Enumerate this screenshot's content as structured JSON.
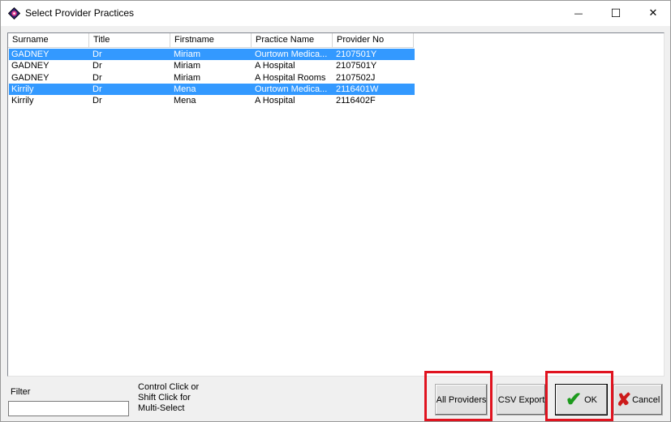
{
  "window": {
    "title": "Select Provider Practices",
    "minimize_glyph": "—",
    "maximize_glyph": "☐",
    "close_glyph": "✕"
  },
  "list": {
    "columns": [
      "Surname",
      "Title",
      "Firstname",
      "Practice Name",
      "Provider No"
    ],
    "rows": [
      {
        "selected": true,
        "cells": [
          "GADNEY",
          "Dr",
          "Miriam",
          "Ourtown Medica...",
          "2107501Y"
        ]
      },
      {
        "selected": false,
        "cells": [
          "GADNEY",
          "Dr",
          "Miriam",
          "A Hospital",
          "2107501Y"
        ]
      },
      {
        "selected": false,
        "cells": [
          "GADNEY",
          "Dr",
          "Miriam",
          "A Hospital Rooms",
          "2107502J"
        ]
      },
      {
        "selected": true,
        "cells": [
          "Kirrily",
          "Dr",
          "Mena",
          "Ourtown Medica...",
          "2116401W"
        ]
      },
      {
        "selected": false,
        "cells": [
          "Kirrily",
          "Dr",
          "Mena",
          "A Hospital",
          "2116402F"
        ]
      }
    ]
  },
  "filter": {
    "label": "Filter",
    "value": ""
  },
  "hint": "Control Click or\nShift Click for\nMulti-Select",
  "buttons": {
    "all_providers": "All Providers",
    "csv_export": "CSV Export",
    "ok": "OK",
    "cancel": "Cancel",
    "ok_icon": "checkmark-icon",
    "cancel_icon": "x-icon"
  },
  "colors": {
    "selection": "#3399ff",
    "highlight": "#e0131f"
  }
}
